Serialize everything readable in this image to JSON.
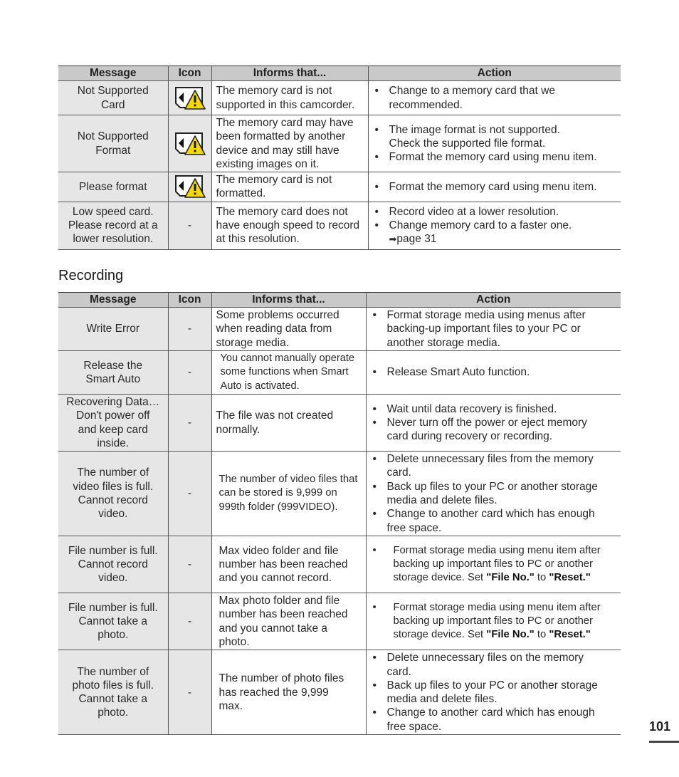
{
  "table1": {
    "headers": [
      "Message",
      "Icon",
      "Informs that...",
      "Action"
    ],
    "rows": [
      {
        "message": [
          "Not Supported",
          "Card"
        ],
        "icon": "card-warning-icon",
        "informs": "The memory card is not supported in this camcorder.",
        "actions": [
          "Change to a memory card that we recommended."
        ]
      },
      {
        "message": [
          "Not Supported",
          "Format"
        ],
        "icon": "card-warning-icon",
        "informs": "The memory card may have been formatted by another device and may still have existing images on it.",
        "actions": [
          "The image format is not supported. Check the supported file format.",
          "Format the memory card using menu item."
        ]
      },
      {
        "message": [
          "Please format"
        ],
        "icon": "card-warning-icon",
        "informs": "The memory card is not formatted.",
        "actions": [
          "Format the memory card using menu item."
        ]
      },
      {
        "message": [
          "Low speed card.",
          "Please record at a",
          "lower resolution."
        ],
        "icon": "-",
        "informs": "The memory card does not have enough speed to record at this resolution.",
        "actions": [
          "Record video at a lower resolution.",
          "Change memory card to a faster one."
        ],
        "page_ref_arrow": "➡",
        "page_ref": "page 31"
      }
    ]
  },
  "section": {
    "title": "Recording"
  },
  "table2": {
    "headers": [
      "Message",
      "Icon",
      "Informs that...",
      "Action"
    ],
    "rows": [
      {
        "message": [
          "Write Error"
        ],
        "icon": "-",
        "informs": "Some problems occurred when reading data from storage media.",
        "actions": [
          "Format storage media using menus after backing-up important files to your PC or another storage media."
        ]
      },
      {
        "message": [
          "Release the",
          "Smart Auto"
        ],
        "icon": "-",
        "informs": "You cannot manually operate some functions when Smart Auto is activated.",
        "actions": [
          "Release Smart Auto function."
        ]
      },
      {
        "message": [
          "Recovering Data…",
          "Don't power off",
          "and keep card",
          "inside."
        ],
        "icon": "-",
        "informs": "The file was not created normally.",
        "actions": [
          "Wait until data recovery is finished.",
          "Never turn off the power or eject memory card during recovery or recording."
        ]
      },
      {
        "message": [
          "The number of",
          "video files is full.",
          "Cannot record",
          "video."
        ],
        "icon": "-",
        "informs": "The number of video files that can be stored is 9,999 on 999th folder (999VIDEO).",
        "actions": [
          "Delete unnecessary files from the memory card.",
          "Back up files to your PC or another storage media and delete files.",
          "Change to another card which has enough free space."
        ]
      },
      {
        "message": [
          "File number is full.",
          "Cannot record",
          "video."
        ],
        "icon": "-",
        "informs": "Max video folder and file number has been reached and you cannot record.",
        "action_prefix": "Format storage media using menu item after backing up important files to PC or another storage device. Set ",
        "action_bold1": "\"File No.\"",
        "action_mid": " to ",
        "action_bold2": "\"Reset.\""
      },
      {
        "message": [
          "File number is full.",
          "Cannot take a",
          "photo."
        ],
        "icon": "-",
        "informs": "Max photo folder and file number has been reached and you cannot take a photo.",
        "action_prefix": "Format storage media using menu item after backing up important files to PC or another storage device. Set ",
        "action_bold1": "\"File No.\"",
        "action_mid": " to ",
        "action_bold2": "\"Reset.\""
      },
      {
        "message": [
          "The number of",
          "photo files is full.",
          "Cannot take a",
          "photo."
        ],
        "icon": "-",
        "informs": "The number of photo files has reached the 9,999 max.",
        "actions": [
          "Delete unnecessary files on the memory card.",
          "Back up files to your PC or another storage media and delete files.",
          "Change to another card which has enough free space."
        ]
      }
    ]
  },
  "page_number": "101",
  "colors": {
    "header_bg": "#c9c9c9",
    "cell_bg": "#e6e6e6",
    "warning_yellow": "#f5d800"
  }
}
